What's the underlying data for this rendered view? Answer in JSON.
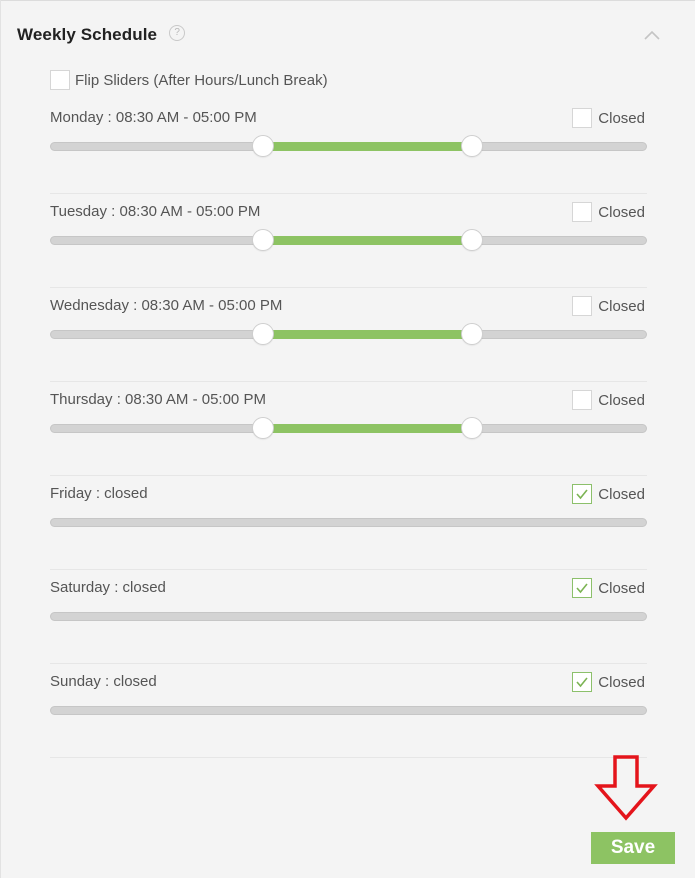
{
  "header": {
    "title": "Weekly Schedule",
    "help_glyph": "?"
  },
  "flip": {
    "label": "Flip Sliders (After Hours/Lunch Break)",
    "checked": false
  },
  "closed_label": "Closed",
  "days": [
    {
      "label": "Monday : 08:30 AM - 05:00 PM",
      "closed": false,
      "range_start": 0.357,
      "range_end": 0.707
    },
    {
      "label": "Tuesday : 08:30 AM - 05:00 PM",
      "closed": false,
      "range_start": 0.357,
      "range_end": 0.707
    },
    {
      "label": "Wednesday : 08:30 AM - 05:00 PM",
      "closed": false,
      "range_start": 0.357,
      "range_end": 0.707
    },
    {
      "label": "Thursday : 08:30 AM - 05:00 PM",
      "closed": false,
      "range_start": 0.357,
      "range_end": 0.707
    },
    {
      "label": "Friday : closed",
      "closed": true
    },
    {
      "label": "Saturday : closed",
      "closed": true
    },
    {
      "label": "Sunday : closed",
      "closed": true
    }
  ],
  "save_label": "Save",
  "colors": {
    "accent": "#8dc363",
    "arrow": "#e4141b",
    "track": "#d3d3d3"
  }
}
